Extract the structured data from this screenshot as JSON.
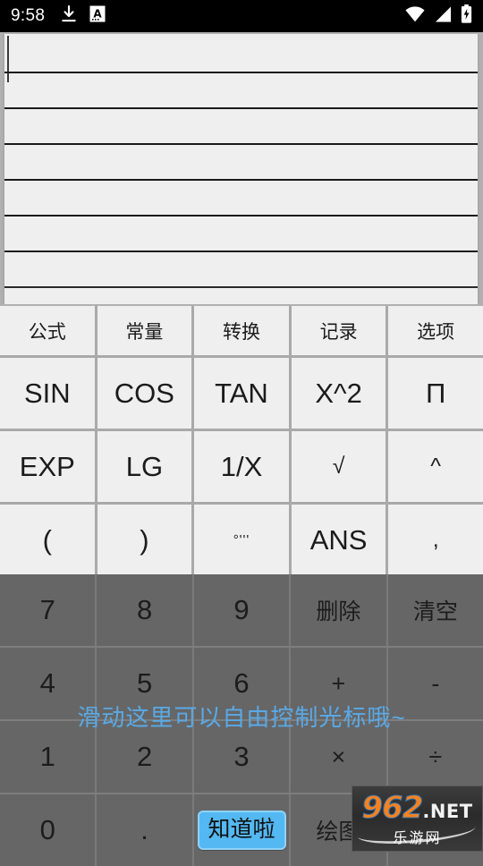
{
  "status_bar": {
    "time": "9:58",
    "left_icons": [
      "download-icon",
      "input-method-a-icon"
    ],
    "right_icons": [
      "wifi-icon",
      "cellular-signal-icon",
      "battery-charging-icon"
    ]
  },
  "display": {
    "content": "",
    "line_count": 7,
    "caret_visible": true,
    "background": "#efeff0",
    "rule_color": "#1a1a1a"
  },
  "menu_row": {
    "items": [
      {
        "label": "公式",
        "name": "menu-formula"
      },
      {
        "label": "常量",
        "name": "menu-constant"
      },
      {
        "label": "转换",
        "name": "menu-convert"
      },
      {
        "label": "记录",
        "name": "menu-history"
      },
      {
        "label": "选项",
        "name": "menu-options"
      }
    ]
  },
  "function_rows": [
    {
      "keys": [
        {
          "label": "SIN",
          "name": "key-sin",
          "size": "normal"
        },
        {
          "label": "COS",
          "name": "key-cos",
          "size": "normal"
        },
        {
          "label": "TAN",
          "name": "key-tan",
          "size": "normal"
        },
        {
          "label": "X^2",
          "name": "key-x-squared",
          "size": "normal"
        },
        {
          "label": "Π",
          "name": "key-pi",
          "size": "normal"
        }
      ]
    },
    {
      "keys": [
        {
          "label": "EXP",
          "name": "key-exp",
          "size": "normal"
        },
        {
          "label": "LG",
          "name": "key-lg",
          "size": "normal"
        },
        {
          "label": "1/X",
          "name": "key-reciprocal",
          "size": "normal"
        },
        {
          "label": "√",
          "name": "key-sqrt",
          "size": "small"
        },
        {
          "label": "^",
          "name": "key-power",
          "size": "small"
        }
      ]
    },
    {
      "keys": [
        {
          "label": "(",
          "name": "key-left-paren",
          "size": "normal"
        },
        {
          "label": ")",
          "name": "key-right-paren",
          "size": "normal"
        },
        {
          "label": "°'''",
          "name": "key-degree-minute-second",
          "size": "tiny"
        },
        {
          "label": "ANS",
          "name": "key-ans",
          "size": "normal"
        },
        {
          "label": ",",
          "name": "key-comma",
          "size": "small"
        }
      ]
    }
  ],
  "numeric_rows": [
    {
      "keys": [
        {
          "label": "7",
          "name": "key-7",
          "style": "num"
        },
        {
          "label": "8",
          "name": "key-8",
          "style": "num"
        },
        {
          "label": "9",
          "name": "key-9",
          "style": "num"
        },
        {
          "label": "删除",
          "name": "key-delete",
          "style": "cn"
        },
        {
          "label": "清空",
          "name": "key-clear",
          "style": "cn"
        }
      ]
    },
    {
      "keys": [
        {
          "label": "4",
          "name": "key-4",
          "style": "num"
        },
        {
          "label": "5",
          "name": "key-5",
          "style": "num"
        },
        {
          "label": "6",
          "name": "key-6",
          "style": "num"
        },
        {
          "label": "+",
          "name": "key-plus",
          "style": "op"
        },
        {
          "label": "-",
          "name": "key-minus",
          "style": "op"
        }
      ]
    },
    {
      "keys": [
        {
          "label": "1",
          "name": "key-1",
          "style": "num"
        },
        {
          "label": "2",
          "name": "key-2",
          "style": "num"
        },
        {
          "label": "3",
          "name": "key-3",
          "style": "num"
        },
        {
          "label": "×",
          "name": "key-multiply",
          "style": "op"
        },
        {
          "label": "÷",
          "name": "key-divide",
          "style": "op"
        }
      ]
    },
    {
      "keys": [
        {
          "label": "0",
          "name": "key-0",
          "style": "num"
        },
        {
          "label": ".",
          "name": "key-decimal-point",
          "style": "dot"
        },
        {
          "label": "知道啦",
          "name": "got-it-button",
          "style": "gotit"
        },
        {
          "label": "绘图",
          "name": "key-plot",
          "style": "cn"
        },
        {
          "label": "",
          "name": "key-blank",
          "style": "num"
        }
      ]
    }
  ],
  "hint": {
    "text": "滑动这里可以自由控制光标哦~",
    "color": "#5aa9e6"
  },
  "watermark": {
    "brand": "962",
    "suffix": ".NET",
    "subtitle": "乐游网"
  },
  "colors": {
    "light_key": "#efeff0",
    "light_divider": "#a9a9a9",
    "dark_key": "#666666",
    "dark_divider": "#7a7a7a",
    "accent_blue": "#54b8f2",
    "status_bar": "#000000"
  }
}
